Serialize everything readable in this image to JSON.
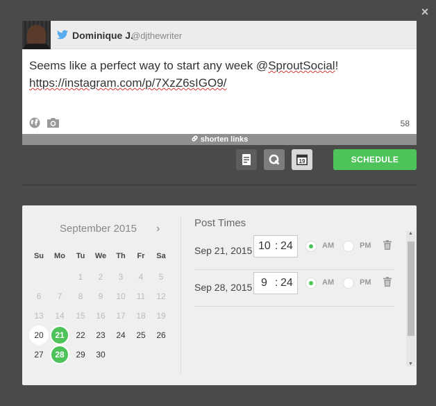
{
  "close_icon": "×",
  "composer": {
    "author_name": "Dominique J.",
    "author_handle": "@djthewriter",
    "text_prefix": "Seems like a perfect way to start any week @",
    "text_mention": "SproutSocial",
    "text_suffix": "!",
    "text_link": "https://instagram.com/p/7XzZ6sIGO9/",
    "char_count": "58",
    "shorten_label": "shorten links"
  },
  "toolbar": {
    "schedule_label": "SCHEDULE",
    "calendar_day": "19"
  },
  "calendar": {
    "month_title": "September 2015",
    "next_arrow": "›",
    "weekdays": [
      "Su",
      "Mo",
      "Tu",
      "We",
      "Th",
      "Fr",
      "Sa"
    ],
    "rows": [
      [
        "",
        "",
        "1",
        "2",
        "3",
        "4",
        "5"
      ],
      [
        "6",
        "7",
        "8",
        "9",
        "10",
        "11",
        "12"
      ],
      [
        "13",
        "14",
        "15",
        "16",
        "17",
        "18",
        "19"
      ],
      [
        "20",
        "21",
        "22",
        "23",
        "24",
        "25",
        "26"
      ],
      [
        "27",
        "28",
        "29",
        "30",
        "",
        "",
        ""
      ]
    ],
    "today": "20",
    "selected": [
      "21",
      "28"
    ]
  },
  "post_times": {
    "title": "Post Times",
    "am_label": "AM",
    "pm_label": "PM",
    "rows": [
      {
        "date": "Sep 21, 2015",
        "hour": "10",
        "sep": ":",
        "minute": "24",
        "period": "AM"
      },
      {
        "date": "Sep 28, 2015",
        "hour": "9",
        "sep": ":",
        "minute": "24",
        "period": "AM"
      }
    ]
  },
  "colors": {
    "accent_green": "#4ec35a",
    "modal_bg": "#4a4a4a",
    "twitter_blue": "#55acee"
  }
}
